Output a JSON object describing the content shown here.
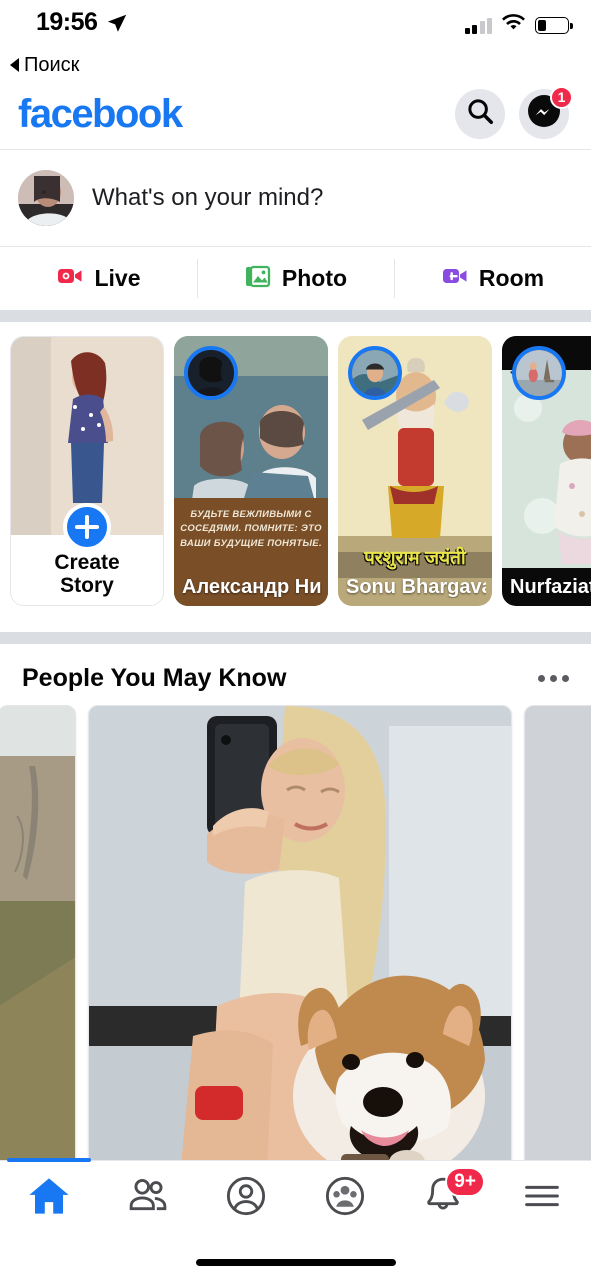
{
  "status_bar": {
    "time": "19:56",
    "location_icon": "location-arrow-icon",
    "signal_icon": "cellular-signal-icon",
    "signal_bars_filled": 2,
    "wifi_icon": "wifi-icon",
    "battery_icon": "battery-icon",
    "battery_level_percent": 30
  },
  "back_nav": {
    "label": "Поиск",
    "icon": "back-triangle-icon"
  },
  "header": {
    "logo_text": "facebook",
    "logo_color": "#1778F2",
    "search_icon": "search-icon",
    "messenger_icon": "messenger-icon",
    "messenger_badge": "1",
    "badge_color": "#f02849"
  },
  "composer": {
    "avatar": "user-avatar",
    "placeholder": "What's on your mind?",
    "actions": [
      {
        "label": "Live",
        "icon": "live-video-icon",
        "color": "#f02849"
      },
      {
        "label": "Photo",
        "icon": "photo-icon",
        "color": "#41b35d"
      },
      {
        "label": "Room",
        "icon": "room-video-icon",
        "color": "#8a4ce0"
      }
    ]
  },
  "stories": {
    "create": {
      "label_line1": "Create",
      "label_line2": "Story",
      "plus_icon": "plus-icon"
    },
    "items": [
      {
        "name": "Александр Николаевич",
        "caption": "Будьте вежливыми с соседями. Помните: это ваши будущие понятые.",
        "avatar_ring_color": "#1877F2"
      },
      {
        "name": "Sonu Bhargava",
        "caption": "परशुराम जयंती",
        "avatar_ring_color": "#1877F2"
      },
      {
        "name": "Nurfaziat",
        "caption": "",
        "avatar_ring_color": "#1877F2"
      }
    ]
  },
  "people_you_may_know": {
    "title": "People You May Know",
    "menu_icon": "more-options-icon",
    "cards": [
      {
        "label": "",
        "type": "photo-outdoor-yard"
      },
      {
        "label": "",
        "type": "photo-woman-with-corgi"
      },
      {
        "label": "",
        "type": "placeholder-card"
      }
    ]
  },
  "bottom_nav": {
    "items": [
      {
        "name": "home",
        "icon": "home-icon",
        "active": true,
        "badge": ""
      },
      {
        "name": "friends",
        "icon": "friends-icon",
        "active": false,
        "badge": ""
      },
      {
        "name": "profile",
        "icon": "profile-icon",
        "active": false,
        "badge": ""
      },
      {
        "name": "groups",
        "icon": "groups-icon",
        "active": false,
        "badge": ""
      },
      {
        "name": "notifications",
        "icon": "bell-icon",
        "active": false,
        "badge": "9+"
      },
      {
        "name": "menu",
        "icon": "hamburger-menu-icon",
        "active": false,
        "badge": ""
      }
    ],
    "active_color": "#1877F2",
    "badge_color": "#f02849"
  }
}
